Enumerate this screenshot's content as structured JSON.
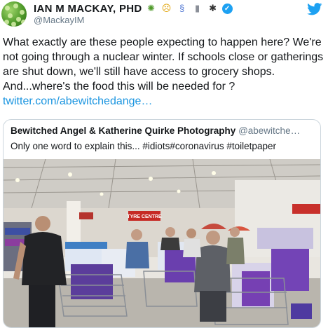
{
  "tweet": {
    "author": {
      "display_name": "IAN M MACKAY, PHD",
      "handle": "@MackayIM",
      "verified": true,
      "name_emojis": [
        "virus-icon",
        "grimacing-face-icon",
        "dna-icon",
        "test-tube-icon",
        "mosquito-icon"
      ]
    },
    "text_lines": [
      "What exactly are these people expecting to happen here? We're",
      "not going through a nuclear winter. If schools close or gatherings",
      "are shut down, we'll still have access to grocery shops.",
      "And...where's the food this will be needed for ?"
    ],
    "link_text": "twitter.com/abewitchedange…",
    "platform_icon": "twitter-bird-icon"
  },
  "quoted_tweet": {
    "display_name": "Bewitched Angel & Katherine Quirke Photography",
    "handle": "@abewitche…",
    "text": "Only one word to explain this... #idiots#coronavirus #toiletpaper",
    "photo": {
      "store_sign": "TYRE CENTRE",
      "description_icon": "store-photo"
    }
  },
  "colors": {
    "link": "#1b95e0",
    "handle": "#657786",
    "border": "#ccd6dd",
    "twitter_blue": "#1da1f2"
  }
}
